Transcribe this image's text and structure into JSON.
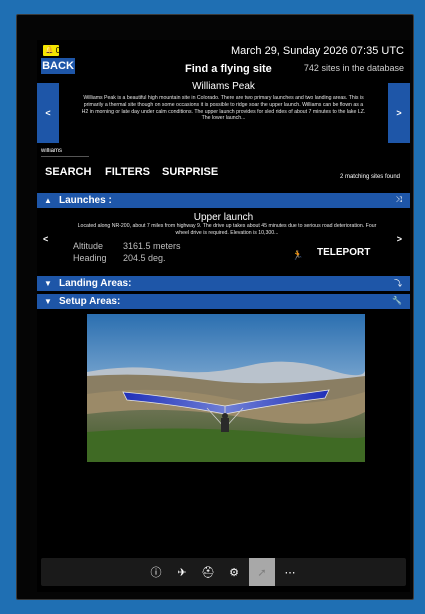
{
  "header": {
    "notification_count": "0",
    "back_label": "BACK",
    "datetime": "March 29, Sunday 2026 07:35 UTC",
    "title": "Find a flying site",
    "db_count": "742 sites in the database"
  },
  "site": {
    "name": "Williams Peak",
    "description": "Williams Peak is a beautiful high mountain site in Colorado.  There are two primary launches and two landing areas.  This is primarily a thermal site though on some occasions it is possible to ridge soar the upper launch.  Williams can be flown as a H2 in morning or late day under calm conditions. The upper launch provides for sled rides of about 7 minutes to the lake LZ.   The lower launch...",
    "prev_label": "<",
    "next_label": ">"
  },
  "search": {
    "value": "williams"
  },
  "actions": {
    "search_label": "SEARCH",
    "filters_label": "FILTERS",
    "surprise_label": "SURPRISE",
    "match_count": "2 matching sites found"
  },
  "launches": {
    "heading": "Launches :",
    "name": "Upper launch",
    "description": "Located along NR-200, about 7 miles from highway 9.   The drive up takes about 45 minutes due to serious road deterioration. Four wheel drive is required.  Elevation is 10,300...",
    "prev_label": "<",
    "next_label": ">",
    "altitude_label": "Altitude",
    "altitude_value": "3161.5 meters",
    "heading_label": "Heading",
    "heading_value": "204.5 deg.",
    "teleport_label": "TELEPORT"
  },
  "landing": {
    "heading": "Landing Areas:"
  },
  "setup": {
    "heading": "Setup Areas:"
  },
  "toolbar": {
    "icons": [
      "info-icon",
      "airplane-icon",
      "pilot-helmet-icon",
      "gear-icon",
      "glider-icon",
      "grid-menu-icon"
    ]
  },
  "colors": {
    "accent_blue": "#1e56a8",
    "background_blue": "#1f6fb3",
    "notification_yellow": "#f5e600"
  }
}
